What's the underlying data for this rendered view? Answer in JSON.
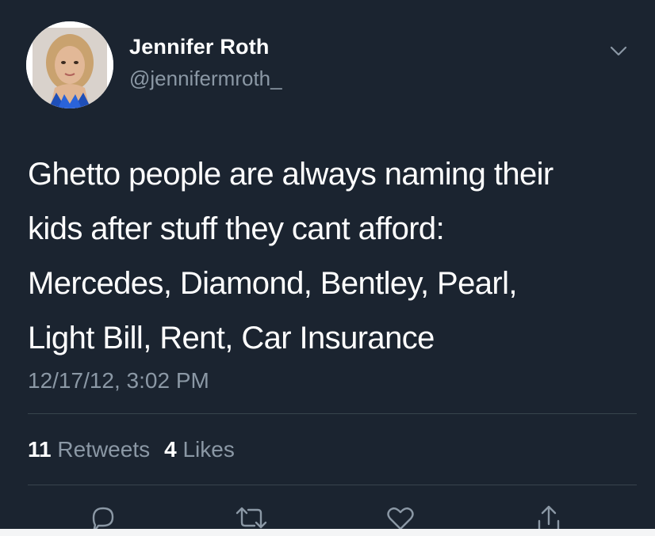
{
  "tweet": {
    "author": {
      "display_name": "Jennifer Roth",
      "handle": "@jennifermroth_",
      "avatar": "profile-photo"
    },
    "text_lines": [
      "Ghetto people are always naming their",
      "kids after stuff they cant afford:",
      "Mercedes, Diamond, Bentley, Pearl,",
      "Light Bill, Rent, Car Insurance"
    ],
    "timestamp": "12/17/12, 3:02 PM",
    "stats": {
      "retweets_count": "11",
      "retweets_label": "Retweets",
      "likes_count": "4",
      "likes_label": "Likes"
    },
    "icons": {
      "menu": "chevron-down-icon",
      "reply": "reply-icon",
      "retweet": "retweet-icon",
      "like": "heart-icon",
      "share": "share-icon"
    }
  },
  "colors": {
    "background": "#1b2430",
    "text_primary": "#ffffff",
    "text_secondary": "#8b98a5",
    "divider": "#38444d"
  }
}
